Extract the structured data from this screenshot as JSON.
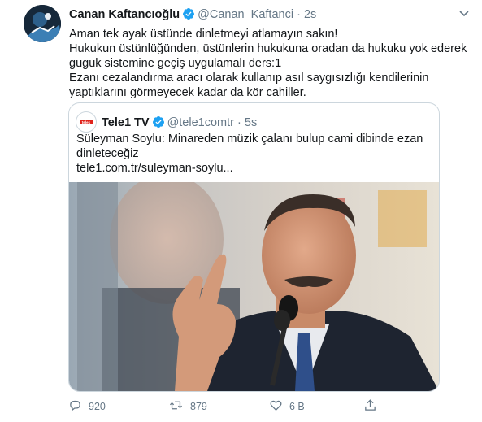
{
  "tweet": {
    "author_name": "Canan Kaftancıoğlu",
    "author_handle": "@Canan_Kaftanci",
    "separator": "·",
    "time": "2s",
    "lines": [
      "Aman tek ayak üstünde dinletmeyi atlamayın sakın!",
      "Hukukun üstünlüğünden, üstünlerin hukukuna oradan da hukuku yok ederek",
      "guguk sistemine geçiş uygulamalı ders:1",
      "Ezanı cezalandırma aracı olarak kullanıp asıl saygısızlığı kendilerinin",
      "yaptıklarını görmeyecek kadar da kör cahiller."
    ]
  },
  "quoted": {
    "author_name": "Tele1 TV",
    "author_handle": "@tele1comtr",
    "separator": "·",
    "time": "5s",
    "lines": [
      "Süleyman Soylu: Minareden müzik çalanı bulup cami dibinde ezan",
      "dinleteceğiz",
      "tele1.com.tr/suleyman-soylu..."
    ],
    "logo_text": "tele1"
  },
  "actions": {
    "reply_count": "920",
    "retweet_count": "879",
    "like_count": "6 B",
    "share_label": ""
  },
  "colors": {
    "verified": "#1da1f2",
    "muted": "#657786",
    "border": "#ccd6dd",
    "link": "#14171a"
  },
  "icons": [
    "verified-badge-icon",
    "chevron-down-icon",
    "reply-icon",
    "retweet-icon",
    "like-icon",
    "share-icon"
  ]
}
